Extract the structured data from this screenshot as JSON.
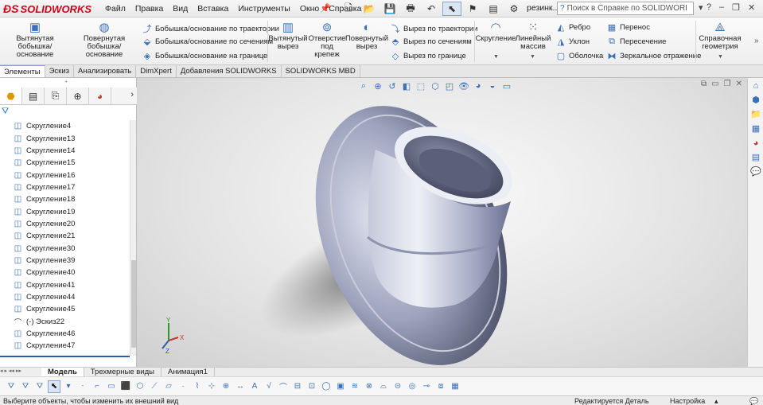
{
  "app": {
    "logo_text": "SOLIDWORKS",
    "doc_name": "резинк..."
  },
  "menu": [
    "Файл",
    "Правка",
    "Вид",
    "Вставка",
    "Инструменты",
    "Окно",
    "Справка"
  ],
  "help_search": {
    "placeholder": "Поиск в Справке по SOLIDWORKS"
  },
  "ribbon": {
    "extrude_boss": "Вытянутая бобышка/основание",
    "revolve_boss": "Повернутая бобышка/основание",
    "sweep_boss": "Бобышка/основание по траектории",
    "loft_boss": "Бобышка/основание по сечениям",
    "boundary_boss": "Бобышка/основание на границе",
    "extrude_cut": "Вытянутый вырез",
    "hole_wizard": "Отверстие под крепеж",
    "revolve_cut": "Повернутый вырез",
    "sweep_cut": "Вырез по траектории",
    "loft_cut": "Вырез по сечениям",
    "boundary_cut": "Вырез по границе",
    "fillet": "Скругление",
    "linear_pattern": "Линейный массив",
    "rib": "Ребро",
    "draft": "Уклон",
    "shell": "Оболочка",
    "wrap": "Перенос",
    "intersect": "Пересечение",
    "mirror": "Зеркальное отражение",
    "ref_geometry": "Справочная геометрия"
  },
  "cmd_tabs": [
    "Элементы",
    "Эскиз",
    "Анализировать",
    "DimXpert",
    "Добавления SOLIDWORKS",
    "SOLIDWORKS MBD"
  ],
  "tree_items": [
    "Скругление4",
    "Скругление13",
    "Скругление14",
    "Скругление15",
    "Скругление16",
    "Скругление17",
    "Скругление18",
    "Скругление19",
    "Скругление20",
    "Скругление21",
    "Скругление30",
    "Скругление39",
    "Скругление40",
    "Скругление41",
    "Скругление44",
    "Скругление45",
    "(-) Эскиз22",
    "Скругление46",
    "Скругление47"
  ],
  "triad": {
    "x": "X",
    "y": "Y",
    "z": "Z"
  },
  "bottom_tabs": [
    "Модель",
    "Трехмерные виды",
    "Анимация1"
  ],
  "status": {
    "hint": "Выберите объекты, чтобы изменить их внешний вид",
    "edit_mode": "Редактируется Деталь",
    "custom": "Настройка"
  },
  "colors": {
    "accent": "#2a5db0",
    "logo_red": "#d0021b",
    "model": "#a9aec6"
  }
}
